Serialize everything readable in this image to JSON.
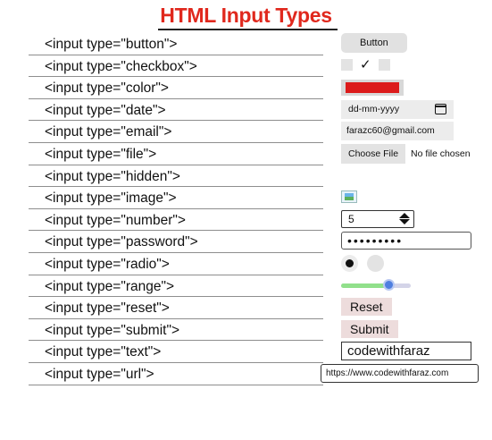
{
  "title": "HTML Input Types",
  "labels": [
    "<input type=\"button\">",
    "<input type=\"checkbox\">",
    "<input type=\"color\">",
    "<input type=\"date\">",
    "<input type=\"email\">",
    "<input type=\"file\">",
    "<input type=\"hidden\">",
    "<input type=\"image\">",
    "<input type=\"number\">",
    "<input type=\"password\">",
    "<input type=\"radio\">",
    "<input type=\"range\">",
    "<input type=\"reset\">",
    "<input type=\"submit\">",
    "<input type=\"text\">",
    "<input type=\"url\">"
  ],
  "controls": {
    "button_label": "Button",
    "checkbox_mark": "✓",
    "color_value": "#dc1b1b",
    "date_placeholder": "dd-mm-yyyy",
    "email_value": "farazc60@gmail.com",
    "file_button": "Choose File",
    "file_status": "No file chosen",
    "number_value": "5",
    "password_value": "•••••••••",
    "range_value": 0.68,
    "reset_label": "Reset",
    "submit_label": "Submit",
    "text_value": "codewithfaraz",
    "url_value": "https://www.codewithfaraz.com"
  }
}
